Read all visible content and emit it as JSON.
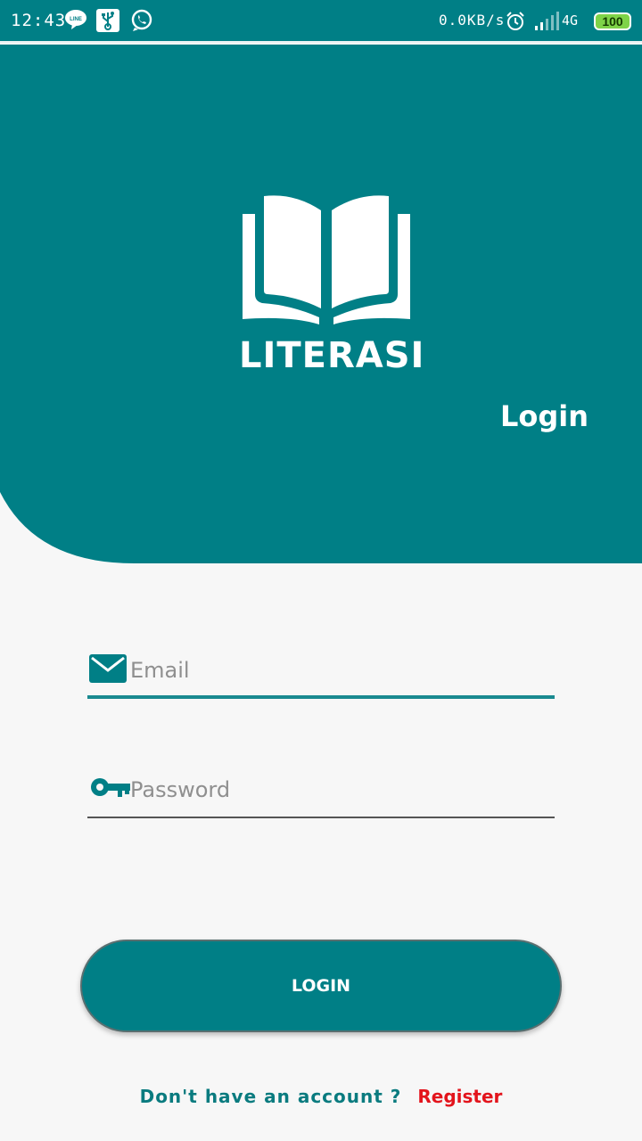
{
  "status_bar": {
    "time": "12:43",
    "network_speed": "0.0KB/s",
    "network_type": "4G",
    "battery": "100",
    "icons": [
      "line-icon",
      "usb-icon",
      "whatsapp-icon",
      "alarm-icon",
      "signal-icon",
      "battery-icon"
    ]
  },
  "colors": {
    "primary": "#007f86",
    "background": "#f7f7f7",
    "link": "#e3141c"
  },
  "header": {
    "brand": "LITERASI",
    "title": "Login"
  },
  "form": {
    "email": {
      "icon": "mail-icon",
      "placeholder": "Email",
      "value": ""
    },
    "password": {
      "icon": "key-icon",
      "placeholder": "Password",
      "value": ""
    },
    "login_label": "LOGIN"
  },
  "footer": {
    "prompt": "Don't have an account ?",
    "register_label": "Register"
  }
}
